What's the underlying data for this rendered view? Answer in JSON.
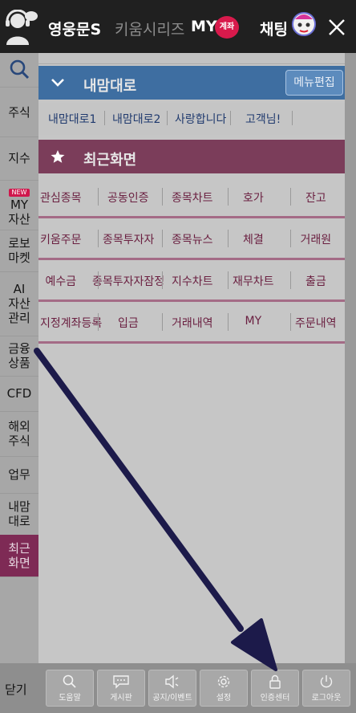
{
  "topbar": {
    "brand": "영웅문S",
    "series": "키움시리즈",
    "my": "MY",
    "my_badge": "계좌",
    "chat": "채팅"
  },
  "sidebar": {
    "items": [
      {
        "label": "주식"
      },
      {
        "label": "지수"
      },
      {
        "tag": "NEW",
        "label": "MY\n자산"
      },
      {
        "label": "로보\n마켓"
      },
      {
        "label": "AI\n자산\n관리"
      },
      {
        "label": "금융\n상품"
      },
      {
        "label": "CFD"
      },
      {
        "label": "해외\n주식"
      },
      {
        "label": "업무"
      },
      {
        "label": "내맘\n대로"
      },
      {
        "label": "최근\n화면"
      }
    ]
  },
  "mine": {
    "title": "내맘대로",
    "edit_label": "메뉴편집",
    "items": [
      "내맘대로1",
      "내맘대로2",
      "사랑합니다",
      "고객님!"
    ]
  },
  "recent": {
    "title": "최근화면",
    "rows": [
      [
        "관심종목",
        "공동인증",
        "종목차트",
        "호가",
        "잔고"
      ],
      [
        "키움주문",
        "종목투자자",
        "종목뉴스",
        "체결",
        "거래원"
      ],
      [
        "예수금",
        "종목투자자잠정",
        "지수차트",
        "재무차트",
        "출금"
      ],
      [
        "지정계좌등록",
        "입금",
        "거래내역",
        "MY",
        "주문내역"
      ]
    ]
  },
  "bottom": {
    "close_label": "닫기",
    "buttons": [
      {
        "label": "도움말",
        "icon": "magnifier-icon"
      },
      {
        "label": "게시판",
        "icon": "chat-bubble-icon"
      },
      {
        "label": "공지/이벤트",
        "icon": "speaker-icon"
      },
      {
        "label": "설정",
        "icon": "gear-icon"
      },
      {
        "label": "인증센터",
        "icon": "lock-icon"
      },
      {
        "label": "로그아웃",
        "icon": "power-icon"
      }
    ]
  },
  "colors": {
    "topbar": "#202020",
    "mine_header": "#3e6ea1",
    "recent_header": "#7b3d5a",
    "selected_side": "#7e2a55",
    "arrow": "#1c1a4a"
  }
}
